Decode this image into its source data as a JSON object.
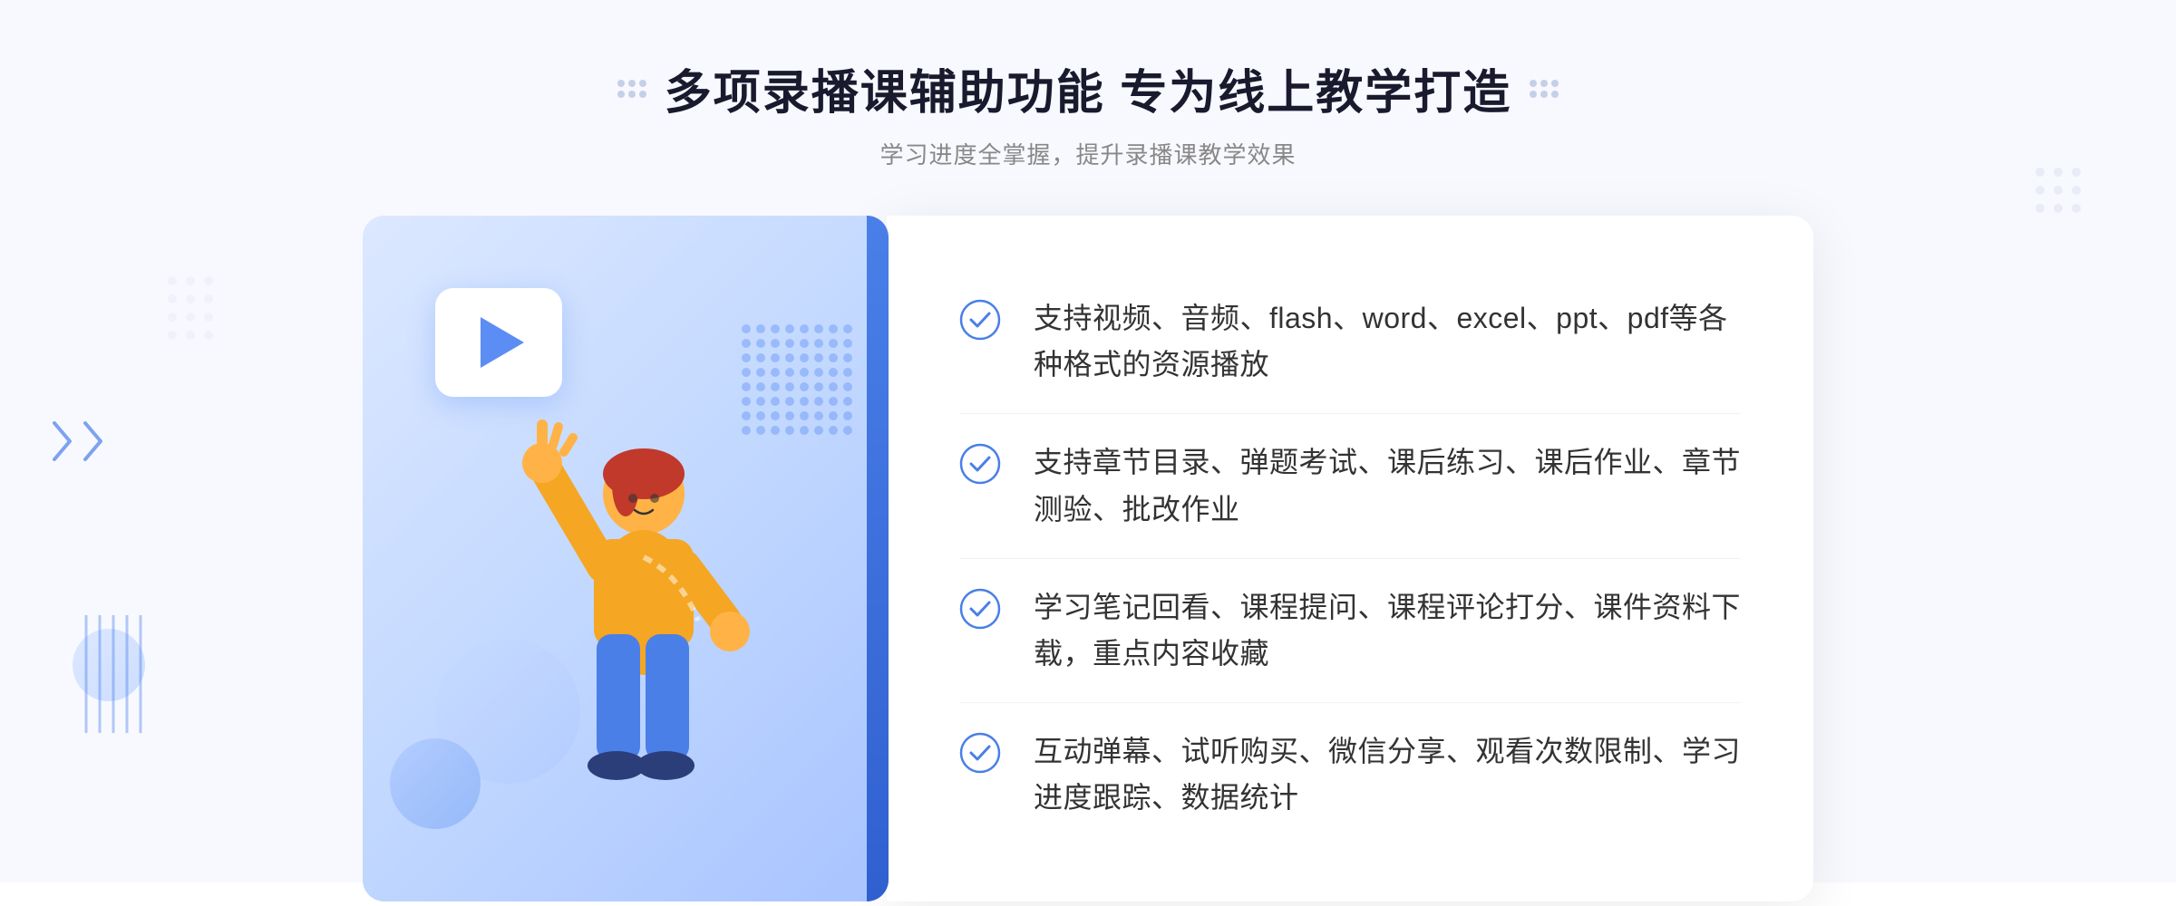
{
  "header": {
    "main_title": "多项录播课辅助功能 专为线上教学打造",
    "sub_title": "学习进度全掌握，提升录播课教学效果"
  },
  "features": [
    {
      "id": "feature-1",
      "text": "支持视频、音频、flash、word、excel、ppt、pdf等各种格式的资源播放"
    },
    {
      "id": "feature-2",
      "text": "支持章节目录、弹题考试、课后练习、课后作业、章节测验、批改作业"
    },
    {
      "id": "feature-3",
      "text": "学习笔记回看、课程提问、课程评论打分、课件资料下载，重点内容收藏"
    },
    {
      "id": "feature-4",
      "text": "互动弹幕、试听购买、微信分享、观看次数限制、学习进度跟踪、数据统计"
    }
  ],
  "colors": {
    "primary": "#4a7fe8",
    "accent": "#3060d0",
    "check_color": "#4a7fe8",
    "title_color": "#1a1a2e",
    "subtitle_color": "#888888",
    "text_color": "#333333"
  },
  "icons": {
    "check": "check-circle-icon",
    "play": "play-icon",
    "chevron": "chevron-right-icon"
  }
}
